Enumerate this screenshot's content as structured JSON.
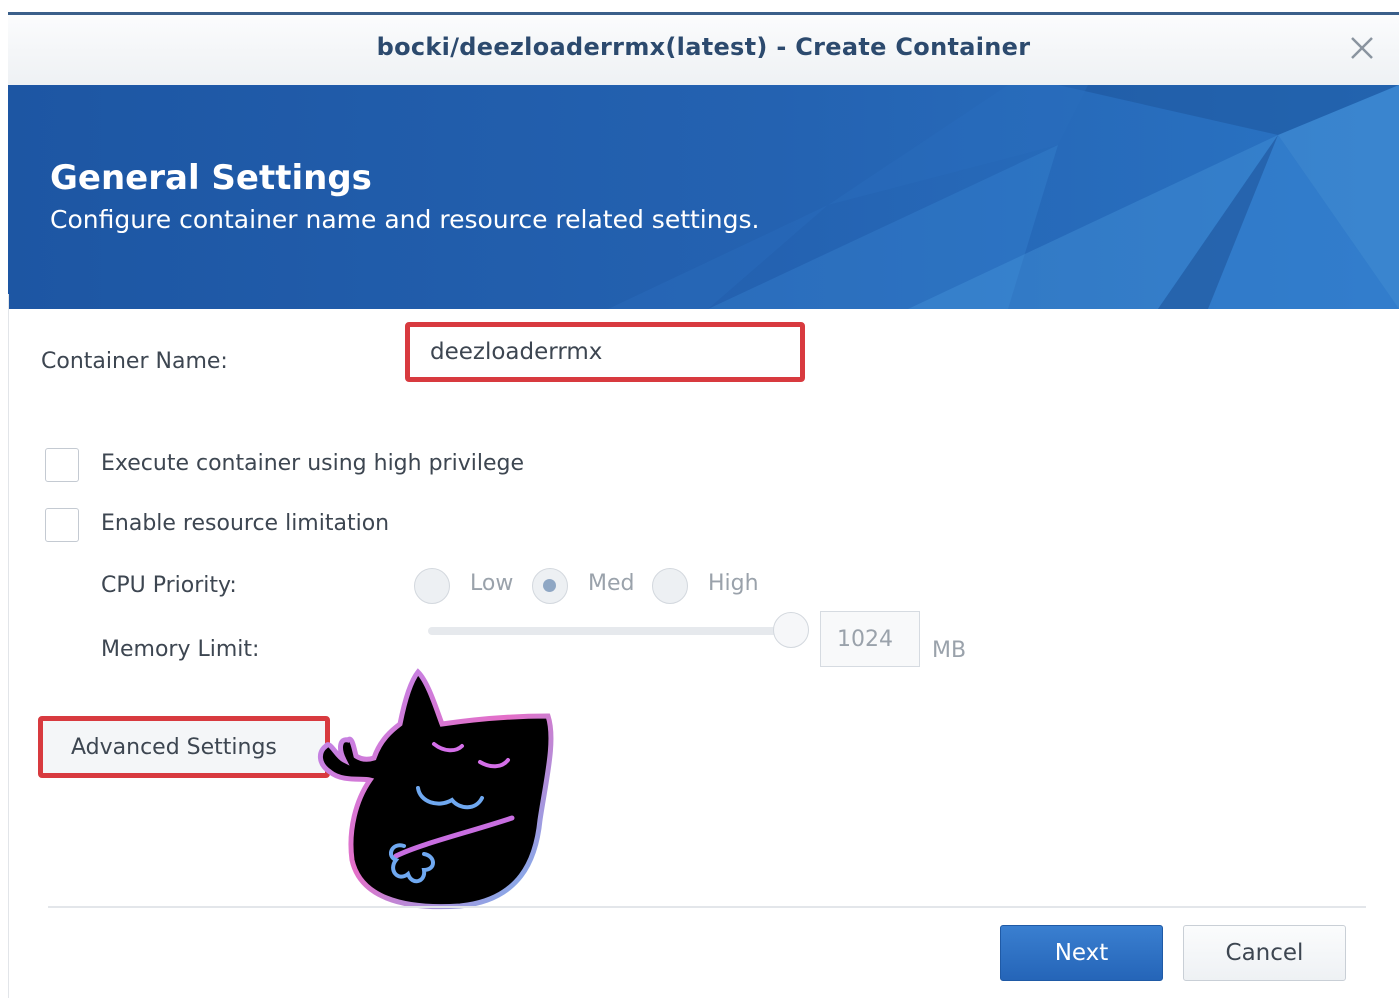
{
  "window": {
    "title": "bocki/deezloaderrmx(latest) - Create Container"
  },
  "banner": {
    "title": "General Settings",
    "subtitle": "Configure container name and resource related settings."
  },
  "form": {
    "container_name_label": "Container Name:",
    "container_name_value": "deezloaderrmx",
    "high_privilege_label": "Execute container using high privilege",
    "high_privilege_checked": false,
    "resource_limit_label": "Enable resource limitation",
    "resource_limit_checked": false,
    "cpu_priority_label": "CPU Priority:",
    "cpu_options": [
      "Low",
      "Med",
      "High"
    ],
    "cpu_selected": "Med",
    "memory_limit_label": "Memory Limit:",
    "memory_value": "1024",
    "memory_unit": "MB"
  },
  "buttons": {
    "advanced_settings": "Advanced Settings",
    "next": "Next",
    "cancel": "Cancel"
  },
  "colors": {
    "accent": "#2565b8",
    "highlight_border": "#d83a3f",
    "banner": "#1f5aa6"
  }
}
